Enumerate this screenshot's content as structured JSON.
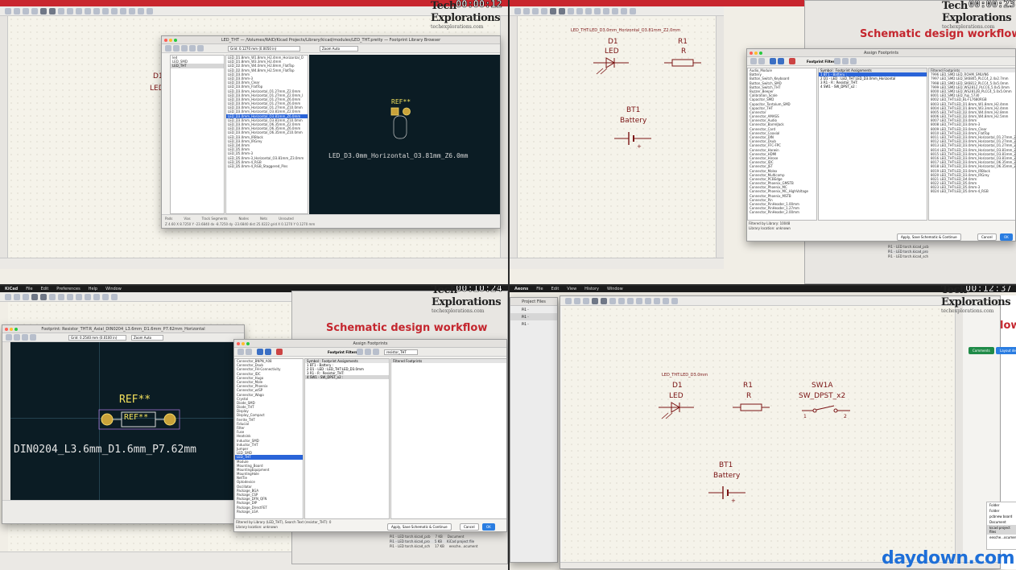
{
  "logo": {
    "line1": "Tech",
    "line2": "Explorations",
    "sub": "techexplorations.com"
  },
  "timers": [
    "00:00:12",
    "00:00:23",
    "00:10:24",
    "00:12:37"
  ],
  "watermark": "daydown.com",
  "q1": {
    "window_title": "LED_THT — /Volumes/RAID/Kicad Projects/Library/kicad/modules/LED_THT.pretty — Footprint Library Browser",
    "grid": "Grid: 0.1270 mm (0.0050 in)",
    "zoom": "Zoom Auto",
    "libraries": [
      "led",
      "LED_SMD",
      "LED_THT"
    ],
    "footprints": [
      "LED_D1.8mm_W1.8mm_H2.4mm_Horizontal_O",
      "LED_D1.8mm_W3.3mm_H2.4mm",
      "LED_D2.0mm_W4.0mm_H2.8mm_FlatTop",
      "LED_D2.0mm_W4.8mm_H2.5mm_FlatTop",
      "LED_D3.0mm",
      "LED_D3.0mm-3",
      "LED_D3.0mm_Clear",
      "LED_D3.0mm_FlatTop",
      "LED_D3.0mm_Horizontal_O1.27mm_Z2.0mm",
      "LED_D3.0mm_Horizontal_O1.27mm_Z2.0mm_I",
      "LED_D3.0mm_Horizontal_O1.27mm_Z6.0mm",
      "LED_D3.0mm_Horizontal_O1.27mm_Z6.0mm",
      "LED_D3.0mm_Horizontal_O1.27mm_Z10.0mm",
      "LED_D3.0mm_Horizontal_O3.81mm_Z2.0mm",
      "LED_D3.0mm_Horizontal_O3.81mm_Z6.0mm",
      "LED_D3.0mm_Horizontal_O3.81mm_Z10.0mm",
      "LED_D3.0mm_Horizontal_O6.35mm_Z2.0mm",
      "LED_D3.0mm_Horizontal_O6.35mm_Z6.0mm",
      "LED_D3.0mm_Horizontal_O6.35mm_Z10.0mm",
      "LED_D3.0mm_IRBlack",
      "LED_D3.0mm_IRGrey",
      "LED_D4.0mm",
      "LED_D5.0mm",
      "LED_D5.0mm-3",
      "LED_D5.0mm-3_Horizontal_O3.81mm_Z3.0mm",
      "LED_D5.0mm-4_RGB",
      "LED_D5.0mm-4_RGB_Staggered_Pins"
    ],
    "selected_index": 14,
    "ref": "REF**",
    "fp_name": "LED_D3.0mm_Horizontal_O3.81mm_Z6.0mm",
    "status_labels": [
      "Pads",
      "Vias",
      "Track Segments",
      "Nodes",
      "Nets",
      "Unrouted"
    ],
    "status_values": [
      "2",
      "0",
      "0",
      "0",
      "0",
      "0"
    ],
    "coords": "Z 4.60   X 8.7250  Y -23.6840      dx -8.7250  dy -23.6840  dist 25.0222      grid X 0.1270  Y 0.1270 mm",
    "sch_symbol_left": "D1",
    "sch_value_left": "LED"
  },
  "q2": {
    "sheet_label": "LED_THT:LED_D3.0mm_Horizontal_O3.81mm_Z2.0mm",
    "d1": "D1",
    "led": "LED",
    "r1": "R1",
    "r": "R",
    "bt1": "BT1",
    "battery": "Battery",
    "slide_title": "Schematic design workflow",
    "dialog_title": "Assign Footprints",
    "filter_label": "Footprint Filters:",
    "col_symbol": "Symbol : Footprint Assignments",
    "col_filtered": "Filtered Footprints",
    "assignments": [
      "1      BT1 -           Battery :",
      "2      D1 -       LED : LED_THT:LED_D3.0mm_Horizontal",
      "3      R1 -            R : Resistor_THT:",
      "4      SW1 -       SW_DPST_x2 :"
    ],
    "libraries": [
      "Audio_Module",
      "Battery",
      "Button_Switch_Keyboard",
      "Button_Switch_SMD",
      "Button_Switch_THT",
      "Buzzer_Beeper",
      "Calibration_Scale",
      "Capacitor_SMD",
      "Capacitor_Tantalum_SMD",
      "Capacitor_THT",
      "Connector",
      "Connector_AMASS",
      "Connector_Audio",
      "Connector_BarrelJack",
      "Connector_Card",
      "Connector_Coaxial",
      "Connector_DIN",
      "Connector_Dsub",
      "Connector_FFC-FPC",
      "Connector_Harwin",
      "Connector_HDMI",
      "Connector_Hirose",
      "Connector_IDC",
      "Connector_JST",
      "Connector_Molex",
      "Connector_Multicomp",
      "Connector_PCBEdge",
      "Connector_Phoenix_GMSTB",
      "Connector_Phoenix_MC",
      "Connector_Phoenix_MC_HighVoltage",
      "Connector_Phoenix_MSTB",
      "Connector_Pin",
      "Connector_PinHeader_1.00mm",
      "Connector_PinHeader_1.27mm",
      "Connector_PinHeader_2.00mm"
    ],
    "footprints": [
      "7996 LED_SMD:LED_ROHM_SMLVN6",
      "7997 LED_SMD:LED_SK6805_PLCC4_2.4x2.7mm",
      "7998 LED_SMD:LED_SK6812_PLCC4_5.0x5.0mm",
      "7999 LED_SMD:LED_WS2812_PLCC6_5.0x5.0mm",
      "8000 LED_SMD:LED_WS2812B_PLCC4_5.0x5.0mm",
      "8001 LED_SMD:LED_Yuji_5730",
      "8002 LED_THT:LED_BL-FL7680RGB",
      "8003 LED_THT:LED_D1.8mm_W1.8mm_H2.4mm",
      "8004 LED_THT:LED_D1.8mm_W3.3mm_H2.4mm",
      "8005 LED_THT:LED_D2.0mm_W4.0mm_H2.8mm",
      "8006 LED_THT:LED_D2.0mm_W4.8mm_H2.5mm",
      "8007 LED_THT:LED_D3.0mm",
      "8008 LED_THT:LED_D3.0mm-3",
      "8009 LED_THT:LED_D3.0mm_Clear",
      "8010 LED_THT:LED_D3.0mm_FlatTop",
      "8011 LED_THT:LED_D3.0mm_Horizontal_O1.27mm_Z2.0mm",
      "8012 LED_THT:LED_D3.0mm_Horizontal_O1.27mm_Z6.0mm",
      "8013 LED_THT:LED_D3.0mm_Horizontal_O1.27mm_Z10.0mm",
      "8014 LED_THT:LED_D3.0mm_Horizontal_O3.81mm_Z2.0mm",
      "8015 LED_THT:LED_D3.0mm_Horizontal_O3.81mm_Z6.0mm",
      "8016 LED_THT:LED_D3.0mm_Horizontal_O3.81mm_Z10.0mm",
      "8017 LED_THT:LED_D3.0mm_Horizontal_O6.35mm_Z2.0mm",
      "8018 LED_THT:LED_D3.0mm_Horizontal_O6.35mm_Z6.0mm",
      "8019 LED_THT:LED_D3.0mm_IRBlack",
      "8020 LED_THT:LED_D3.0mm_IRGrey",
      "8021 LED_THT:LED_D4.0mm",
      "8022 LED_THT:LED_D5.0mm",
      "8023 LED_THT:LED_D5.0mm-3",
      "8024 LED_THT:LED_D5.0mm-4_RGB"
    ],
    "filtered_by": "Filtered by Library: 10048",
    "lib_location": "Library location: unknown",
    "apply": "Apply, Save Schematic & Continue",
    "cancel": "Cancel",
    "ok": "OK",
    "files": [
      "Pi1 - LED torch.kicad_pcb",
      "Pi1 - LED torch.kicad_pro",
      "Pi1 - LED torch.kicad_sch"
    ]
  },
  "q3": {
    "menubar": [
      "KiCad",
      "File",
      "Edit",
      "Preferences",
      "Help",
      "Window"
    ],
    "fp_title": "Footprint: Resistor_THT:R_Axial_DIN0204_L3.6mm_D1.6mm_P7.62mm_Horizontal",
    "grid": "Grid: 0.2540 mm (0.0100 in)",
    "zoom": "Zoom Auto",
    "ref_top": "REF**",
    "ref_body": "REF**",
    "fp_name": "DIN0204_L3.6mm_D1.6mm_P7.62mm",
    "slide_title": "Schematic design workflow",
    "dialog_title": "Assign Footprints",
    "filter_label": "Footprint Filters:",
    "filter_value": "resistor_THT",
    "col_symbol": "Symbol : Footprint Assignments",
    "col_filtered": "Filtered Footprints",
    "assignments": [
      "1      BT1 -          Battery :",
      "2      D1 -         LED : LED_THT:LED_D3.0mm",
      "3      R1 -              R : Resistor_THT:",
      "4      SW1 -     SW_DPST_x2 :"
    ],
    "libraries": [
      "Connector_BNPN_A08",
      "Connector_Dsub",
      "Connector_FH-Connectivity",
      "Connector_IDC",
      "Connector_Hugo",
      "Connector_Mole",
      "Connector_Phoenix",
      "Connector_w/SP",
      "Connector_Wago",
      "Crystal",
      "Diode_SMD",
      "Diode_THT",
      "Display",
      "Display_Compact",
      "Ferrite_THT",
      "Fiducial",
      "Filter",
      "Fuse",
      "Heatsink",
      "Inductor_SMD",
      "Inductor_THT",
      "Jumper",
      "LED_SMD",
      "LED_THT",
      "Module",
      "Mounting_Board",
      "MountingEquipment",
      "MountingHole",
      "NetTie",
      "Optodevice",
      "Oscillator",
      "Package_BGA",
      "Package_CSP",
      "Package_DFN_QFN",
      "Package_DIP",
      "Package_DirectFET",
      "Package_LGA"
    ],
    "selected_lib_index": 23,
    "filtered_by": "Filtered by Library (LED_THT), Search Text (resistor_THT): 0",
    "lib_location": "Library location: unknown",
    "apply": "Apply, Save Schematic & Continue",
    "cancel": "Cancel",
    "ok": "OK",
    "files": [
      "Pi1 - LED torch.kicad_pcb",
      "Pi1 - LED torch.kicad_pro",
      "Pi1 - LED torch.kicad_sch"
    ],
    "file_sizes": [
      "7 KB",
      "5 KB",
      "17 KB"
    ],
    "file_kinds": [
      "Document",
      "KiCad project file",
      "eesche...ocument"
    ]
  },
  "q4": {
    "menubar": [
      "Aeons",
      "File",
      "Edit",
      "View",
      "History",
      "Window"
    ],
    "sheet_label": "LED_THT:LED_D3.0mm",
    "d1": "D1",
    "led": "LED",
    "r1": "R1",
    "r": "R",
    "sw": "SW1A",
    "sw_value": "SW_DPST_x2",
    "bt1": "BT1",
    "battery": "Battery",
    "slide_title": "low",
    "btn1": "Comments",
    "btn2": "Layout design",
    "project_files": "Project Files",
    "tree": [
      "Pi1 -",
      "Pi1 -",
      "Pi1 -"
    ],
    "side_menu": [
      "Folder",
      "Folder",
      "pcbnew board",
      "Document",
      "kicad project files",
      "eesche...ocument"
    ]
  }
}
